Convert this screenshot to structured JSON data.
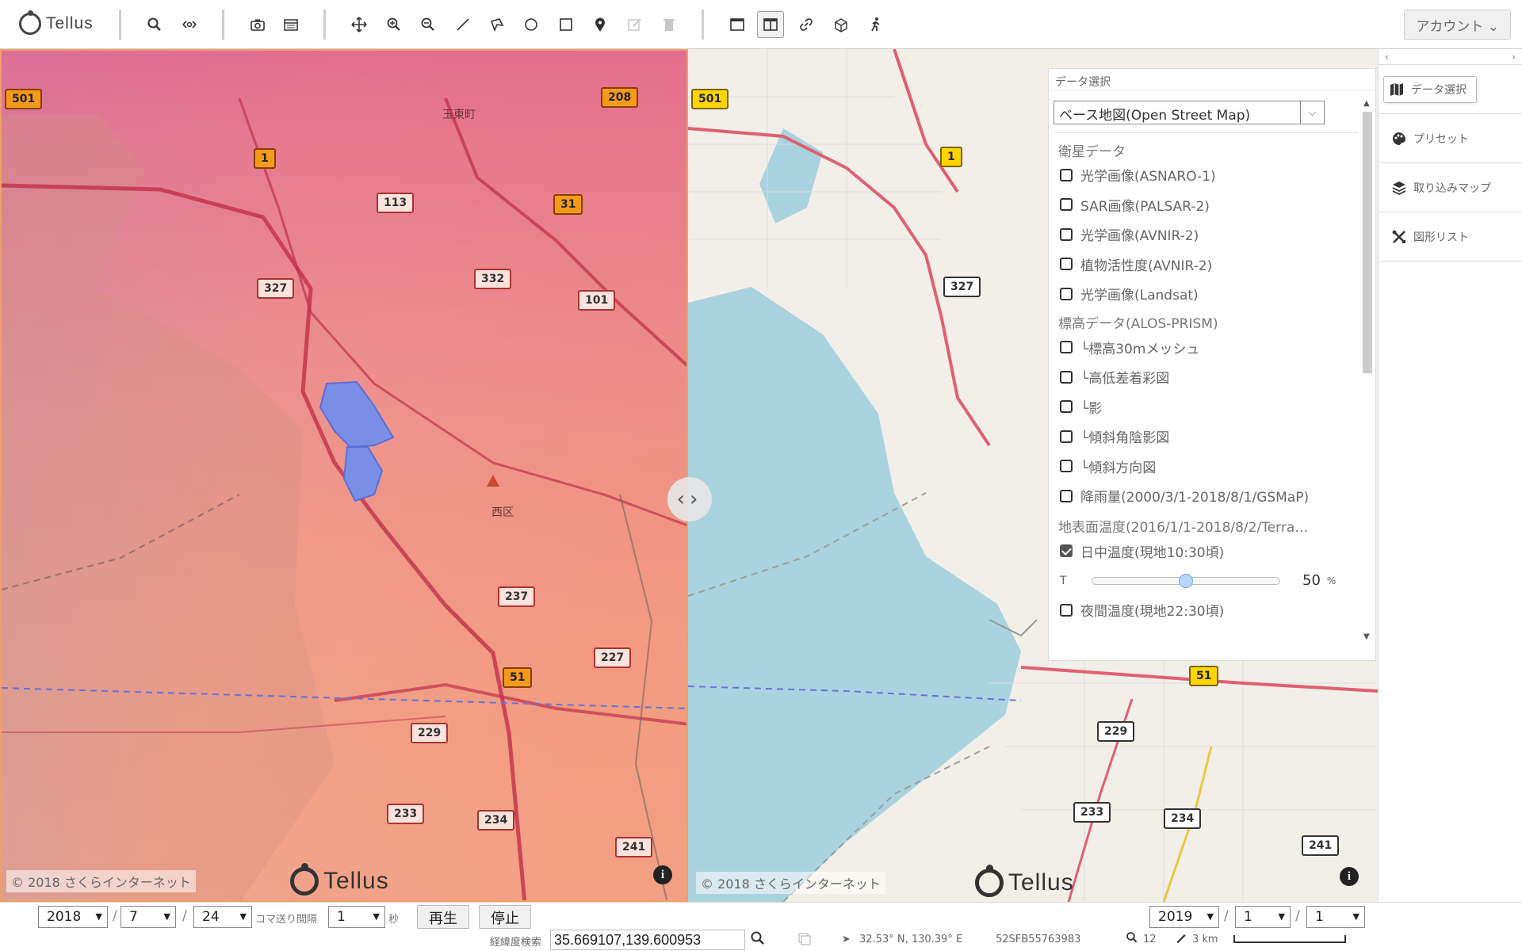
{
  "toolbar": {
    "logo_text": "Tellus",
    "account_label": "アカウント ⌄"
  },
  "maps": {
    "left": {
      "copyright": "© 2018 さくらインターネット",
      "logo_text": "Tellus",
      "routes": [
        "501",
        "208",
        "1",
        "113",
        "31",
        "327",
        "332",
        "101",
        "237",
        "227",
        "51",
        "229",
        "233",
        "234",
        "241"
      ],
      "places": [
        "玉東町",
        "西区"
      ]
    },
    "right": {
      "copyright": "© 2018 さくらインターネット",
      "logo_text": "Tellus",
      "routes": [
        "501",
        "1",
        "327",
        "51",
        "229",
        "233",
        "234",
        "241"
      ]
    }
  },
  "data_panel": {
    "title": "データ選択",
    "base_map": "ベース地図(Open Street Map)",
    "categories": {
      "satellite": "衛星データ",
      "elevation": "標高データ(ALOS-PRISM)",
      "surface_temp": "地表面温度(2016/1/1-2018/8/2/Terra…"
    },
    "satellite_layers": [
      {
        "label": "光学画像(ASNARO-1)",
        "checked": false
      },
      {
        "label": "SAR画像(PALSAR-2)",
        "checked": false
      },
      {
        "label": "光学画像(AVNIR-2)",
        "checked": false
      },
      {
        "label": "植物活性度(AVNIR-2)",
        "checked": false
      },
      {
        "label": "光学画像(Landsat)",
        "checked": false
      }
    ],
    "elevation_layers": [
      {
        "label": "└標高30mメッシュ",
        "checked": false
      },
      {
        "label": "└高低差着彩図",
        "checked": false
      },
      {
        "label": "└影",
        "checked": false
      },
      {
        "label": "└傾斜角陰影図",
        "checked": false
      },
      {
        "label": "└傾斜方向図",
        "checked": false
      }
    ],
    "rainfall_layer": {
      "label": "降雨量(2000/3/1-2018/8/1/GSMaP)",
      "checked": false
    },
    "day_temp": {
      "label": "日中温度(現地10:30頃)",
      "checked": true
    },
    "opacity": {
      "t_label": "T",
      "value": "50",
      "fraction": 0.5,
      "unit": "%"
    },
    "night_temp": {
      "label": "夜間温度(現地22:30頃)",
      "checked": false
    }
  },
  "sidebar": {
    "items": [
      {
        "label": "データ選択",
        "icon": "map-icon"
      },
      {
        "label": "プリセット",
        "icon": "palette-icon"
      },
      {
        "label": "取り込みマップ",
        "icon": "layers-icon"
      },
      {
        "label": "図形リスト",
        "icon": "tools-icon"
      }
    ]
  },
  "timebar": {
    "left_year": "2018",
    "left_month": "7",
    "left_day": "24",
    "interval_label": "コマ送り間隔",
    "interval_value": "1",
    "interval_unit": "秒",
    "play_label": "再生",
    "stop_label": "停止",
    "right_year": "2019",
    "right_month": "1",
    "right_day": "1",
    "slash": "/"
  },
  "statusbar": {
    "search_label": "経緯度検索",
    "coords": "35.669107,139.600953",
    "cursor_pos": "32.53° N, 130.39° E",
    "mgrs": "52SFB55763983",
    "zoom": "12",
    "scale": "3 km"
  }
}
